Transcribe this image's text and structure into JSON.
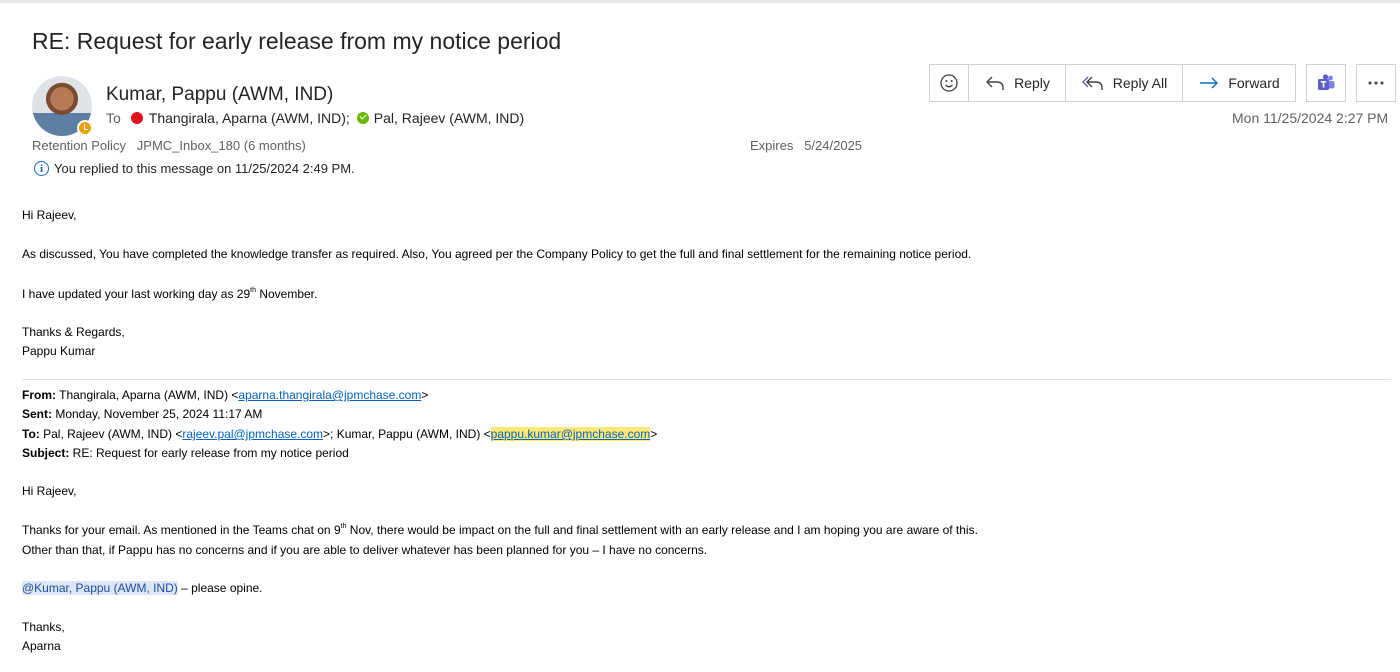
{
  "email": {
    "subject": "RE: Request for early release from my notice period",
    "sender": "Kumar, Pappu (AWM, IND)",
    "to_label": "To",
    "recipient1": "Thangirala, Aparna (AWM, IND);",
    "recipient2": "Pal, Rajeev (AWM, IND)",
    "retention_label": "Retention Policy",
    "retention_value": "JPMC_Inbox_180 (6 months)",
    "expires_label": "Expires",
    "expires_value": "5/24/2025",
    "replied_notice": "You replied to this message on 11/25/2024 2:49 PM.",
    "date": "Mon 11/25/2024 2:27 PM"
  },
  "toolbar": {
    "reply": "Reply",
    "reply_all": "Reply All",
    "forward": "Forward",
    "icons": [
      "emoji-icon",
      "reply-icon",
      "reply-all-icon",
      "forward-icon",
      "teams-icon",
      "more-icon"
    ]
  },
  "body": {
    "greeting": "Hi Rajeev,",
    "line1": "As discussed, You have completed the knowledge transfer as required. Also, You agreed per the Company Policy to get the full and final settlement for the remaining notice period.",
    "line2_pre": "I have updated your last working day as 29",
    "line2_sup": "th",
    "line2_post": " November.",
    "signoff": "Thanks & Regards,",
    "signature": "Pappu Kumar"
  },
  "quoted": {
    "from_label": "From:",
    "from_name": " Thangirala, Aparna (AWM, IND) <",
    "from_email": "aparna.thangirala@jpmchase.com",
    "from_close": ">",
    "sent_label": "Sent:",
    "sent_value": " Monday, November 25, 2024 11:17 AM",
    "to_label": "To:",
    "to_name1": " Pal, Rajeev (AWM, IND) <",
    "to_email1": "rajeev.pal@jpmchase.com",
    "to_name2": ">; Kumar, Pappu (AWM, IND) <",
    "to_email2": "pappu.kumar@jpmchase.com",
    "to_close": ">",
    "subject_label": "Subject:",
    "subject_value": " RE: Request for early release from my notice period",
    "greeting": "Hi Rajeev,",
    "line1_pre": "Thanks for your email. As mentioned in the Teams chat on 9",
    "line1_sup": "th",
    "line1_post": " Nov, there would be impact on the full and final settlement with an early release and I am hoping you are aware of this.",
    "line2": "Other than that, if Pappu has no concerns and if you are able to deliver whatever has been planned for you – I have no concerns.",
    "mention": "@Kumar, Pappu (AWM, IND)",
    "mention_after": " – please opine.",
    "signoff": "Thanks,",
    "signature": "Aparna"
  },
  "colors": {
    "link": "#0563c1",
    "highlight": "#ffe873",
    "presence_busy": "#e0111d",
    "presence_available": "#6bb700",
    "presence_away": "#eaa300",
    "teams": "#5b5fc7"
  }
}
